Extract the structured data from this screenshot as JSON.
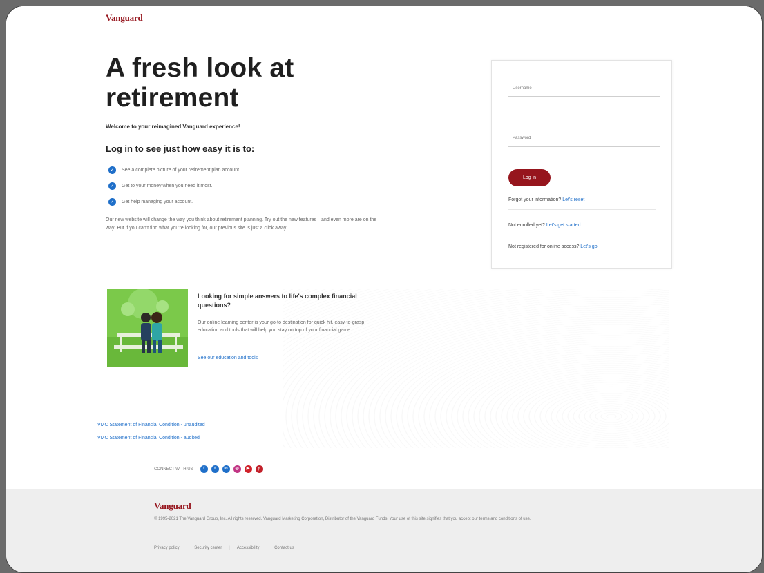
{
  "header": {
    "logo_text": "Vanguard"
  },
  "hero": {
    "title": "A fresh look at retirement",
    "welcome": "Welcome to your reimagined Vanguard experience!",
    "subtitle": "Log in to see just how easy it is to:",
    "bullets": [
      "See a complete picture of your retirement plan account.",
      "Get to your money when you need it most.",
      "Get help managing your account."
    ],
    "paragraph": "Our new website will change the way you think about retirement planning. Try out the new features—and even more are on the way! But if you can't find what you're looking for, our previous site is just a click away."
  },
  "login": {
    "username_placeholder": "Username",
    "password_placeholder": "Password",
    "login_label": "Log in",
    "forgot_text": "Forgot your information?",
    "forgot_link": "Let's reset",
    "enroll_text": "Not enrolled yet?",
    "enroll_link": "Let's get started",
    "register_text": "Not registered for online access?",
    "register_link": "Let's go"
  },
  "promo": {
    "title": "Looking for simple answers to life's complex financial questions?",
    "text": "Our online learning center is your go-to destination for quick hit, easy-to-grasp education and tools that will help you stay on top of your financial game.",
    "link": "See our education and tools"
  },
  "documents": {
    "unaudited": "VMC Statement of Financial Condition - unaudited",
    "audited": "VMC Statement of Financial Condition - audited"
  },
  "social": {
    "label": "CONNECT WITH US",
    "icons": [
      {
        "name": "facebook-icon",
        "glyph": "f",
        "color": "#1f6fc9"
      },
      {
        "name": "twitter-icon",
        "glyph": "t",
        "color": "#1f6fc9"
      },
      {
        "name": "linkedin-icon",
        "glyph": "in",
        "color": "#1f6fc9"
      },
      {
        "name": "instagram-icon",
        "glyph": "◎",
        "color": "#c13584"
      },
      {
        "name": "youtube-icon",
        "glyph": "▶",
        "color": "#d0212a"
      },
      {
        "name": "pinterest-icon",
        "glyph": "p",
        "color": "#c2202a"
      }
    ]
  },
  "footer": {
    "logo_text": "Vanguard",
    "legal": "© 1995-2021 The Vanguard Group, Inc. All rights reserved. Vanguard Marketing Corporation, Distributor of the Vanguard Funds. Your use of this site signifies that you accept our terms and conditions of use.",
    "links": [
      "Privacy policy",
      "Security center",
      "Accessibility",
      "Contact us"
    ]
  },
  "colors": {
    "brand": "#96151d",
    "link": "#1f6fc9",
    "promo_bg": "#7bc94a"
  }
}
